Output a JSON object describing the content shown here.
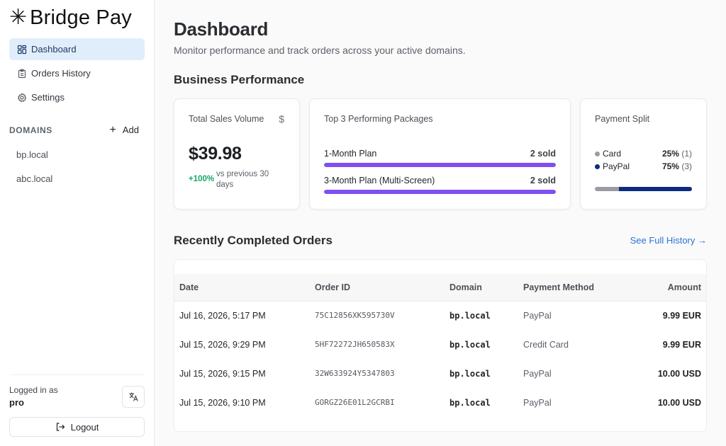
{
  "brand": {
    "mark": "✳",
    "name": "Bridge Pay"
  },
  "nav": [
    {
      "label": "Dashboard",
      "icon": "dashboard-grid-icon",
      "active": true
    },
    {
      "label": "Orders History",
      "icon": "clipboard-icon",
      "active": false
    },
    {
      "label": "Settings",
      "icon": "gear-icon",
      "active": false
    }
  ],
  "domains": {
    "title": "DOMAINS",
    "add_label": "Add",
    "items": [
      "bp.local",
      "abc.local"
    ]
  },
  "footer": {
    "logged_in_label": "Logged in as",
    "username": "pro",
    "logout_label": "Logout"
  },
  "header": {
    "title": "Dashboard",
    "subtitle": "Monitor performance and track orders across your active domains."
  },
  "performance": {
    "title": "Business Performance",
    "sales": {
      "label": "Total Sales Volume",
      "currency_symbol": "$",
      "value": "$39.98",
      "delta": "+100%",
      "delta_note": "vs previous 30 days"
    },
    "packages": {
      "label": "Top 3 Performing Packages",
      "items": [
        {
          "name": "1-Month Plan",
          "sold": "2 sold",
          "share": 1.0
        },
        {
          "name": "3-Month Plan (Multi-Screen)",
          "sold": "2 sold",
          "share": 1.0
        }
      ]
    },
    "split": {
      "label": "Payment Split",
      "items": [
        {
          "name": "Card",
          "percent": "25%",
          "count": "(1)",
          "fraction": 0.25,
          "color": "#9a9ca1"
        },
        {
          "name": "PayPal",
          "percent": "75%",
          "count": "(3)",
          "fraction": 0.75,
          "color": "#0d2a80"
        }
      ]
    }
  },
  "orders": {
    "title": "Recently Completed Orders",
    "see_full_history": "See Full History →",
    "columns": [
      "Date",
      "Order ID",
      "Domain",
      "Payment Method",
      "Amount"
    ],
    "rows": [
      {
        "date": "Jul 16, 2026, 5:17 PM",
        "order_id": "75C12856XK595730V",
        "domain": "bp.local",
        "method": "PayPal",
        "amount": "9.99 EUR"
      },
      {
        "date": "Jul 15, 2026, 9:29 PM",
        "order_id": "5HF72272JH650583X",
        "domain": "bp.local",
        "method": "Credit Card",
        "amount": "9.99 EUR"
      },
      {
        "date": "Jul 15, 2026, 9:15 PM",
        "order_id": "32W633924Y5347803",
        "domain": "bp.local",
        "method": "PayPal",
        "amount": "10.00 USD"
      },
      {
        "date": "Jul 15, 2026, 9:10 PM",
        "order_id": "GORGZ26E01L2GCRBI",
        "domain": "bp.local",
        "method": "PayPal",
        "amount": "10.00 USD"
      }
    ]
  },
  "colors": {
    "accent": "#2b74d6",
    "active_nav_bg": "#e0eefc",
    "package_bar": "#7f4ff0",
    "positive": "#18a66a"
  }
}
